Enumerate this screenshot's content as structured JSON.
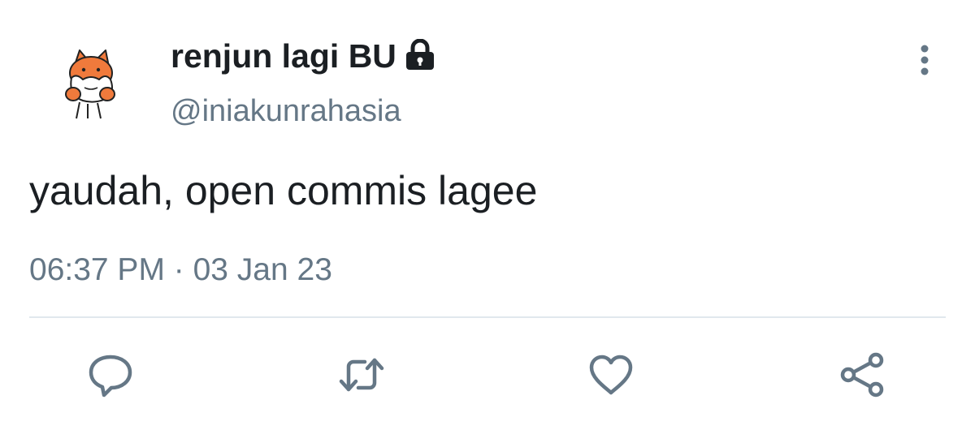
{
  "user": {
    "display_name": "renjun lagi BU",
    "handle": "@iniakunrahasia",
    "protected_icon": "lock-icon",
    "avatar_icon": "cartoon-fox-avatar"
  },
  "tweet": {
    "text": "yaudah, open commis lagee",
    "timestamp": "06:37 PM · 03 Jan 23"
  },
  "actions": [
    {
      "name": "reply",
      "icon": "speech-bubble-icon"
    },
    {
      "name": "retweet",
      "icon": "retweet-arrows-icon"
    },
    {
      "name": "like",
      "icon": "heart-icon"
    },
    {
      "name": "share",
      "icon": "share-nodes-icon"
    }
  ],
  "menu": {
    "icon": "vertical-dots-icon"
  },
  "colors": {
    "text_primary": "#1b1f23",
    "text_secondary": "#657786",
    "divider": "#e1e8ed",
    "avatar_orange": "#f07a3c",
    "background": "#ffffff"
  }
}
